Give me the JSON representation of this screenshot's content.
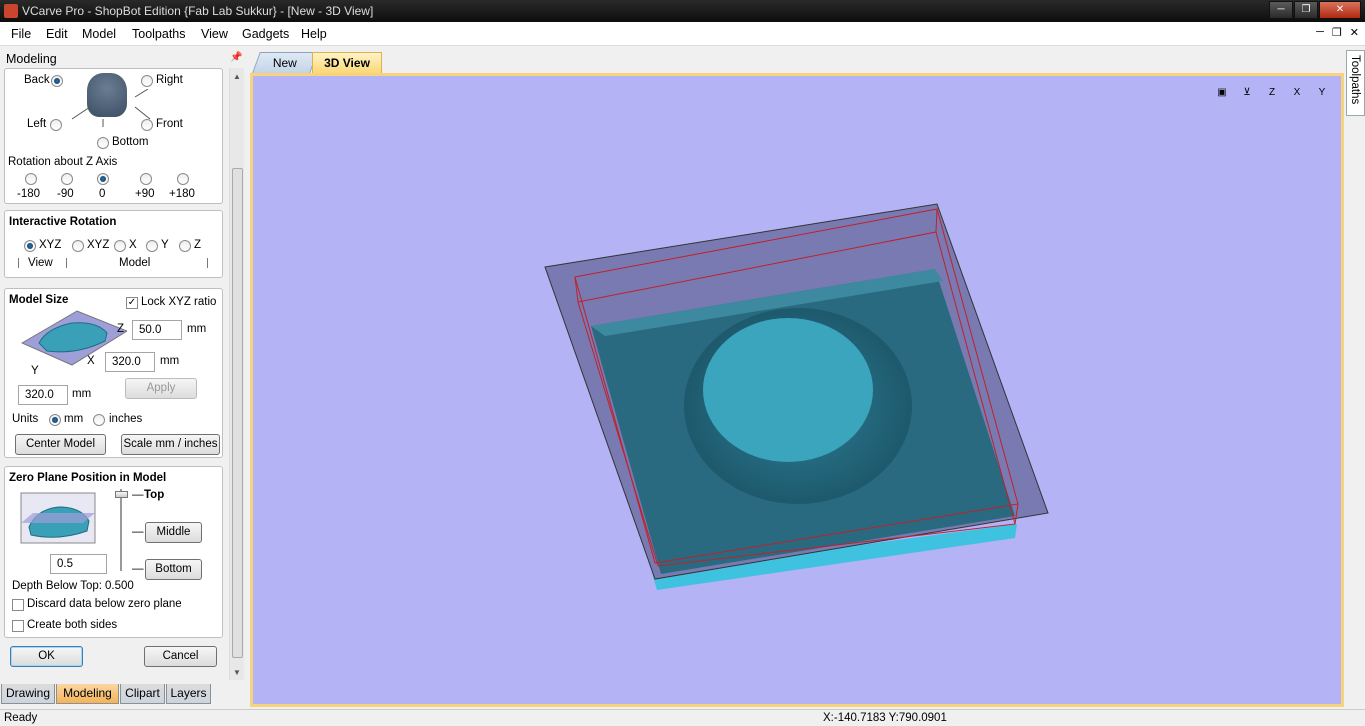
{
  "window": {
    "title": "VCarve Pro - ShopBot Edition {Fab Lab Sukkur} - [New - 3D View]",
    "controls": [
      "minimize",
      "restore",
      "close"
    ]
  },
  "menu": [
    "File",
    "Edit",
    "Model",
    "Toolpaths",
    "View",
    "Gadgets",
    "Help"
  ],
  "panel": {
    "title": "Modeling",
    "orientation": {
      "options": [
        {
          "label": "Back",
          "selected": true
        },
        {
          "label": "Right",
          "selected": false
        },
        {
          "label": "Left",
          "selected": false
        },
        {
          "label": "Front",
          "selected": false
        },
        {
          "label": "Bottom",
          "selected": false
        }
      ],
      "rotation_label": "Rotation about Z Axis",
      "rotation_options": [
        {
          "label": "-180",
          "selected": false
        },
        {
          "label": "-90",
          "selected": false
        },
        {
          "label": "0",
          "selected": true
        },
        {
          "label": "+90",
          "selected": false
        },
        {
          "label": "+180",
          "selected": false
        }
      ]
    },
    "interactive_rotation": {
      "heading": "Interactive Rotation",
      "options": [
        {
          "label": "XYZ",
          "selected": true
        },
        {
          "label": "XYZ",
          "selected": false
        },
        {
          "label": "X",
          "selected": false
        },
        {
          "label": "Y",
          "selected": false
        },
        {
          "label": "Z",
          "selected": false
        }
      ],
      "view_label": "View",
      "model_label": "Model"
    },
    "model_size": {
      "heading": "Model Size",
      "lock_label": "Lock XYZ ratio",
      "lock_checked": true,
      "z_label": "Z",
      "z_value": "50.0",
      "x_label": "X",
      "x_value": "320.0",
      "y_label": "Y",
      "y_value": "320.0",
      "unit": "mm",
      "apply_label": "Apply",
      "units_label": "Units",
      "units_options": [
        {
          "label": "mm",
          "selected": true
        },
        {
          "label": "inches",
          "selected": false
        }
      ],
      "center_label": "Center Model",
      "scale_label": "Scale mm / inches"
    },
    "zero_plane": {
      "heading": "Zero Plane Position in Model",
      "top_label": "Top",
      "middle_label": "Middle",
      "bottom_label": "Bottom",
      "value": "0.5",
      "depth_label": "Depth Below Top:",
      "depth_value": "0.500",
      "discard_label": "Discard data below zero plane",
      "discard_checked": false,
      "both_sides_label": "Create both sides",
      "both_sides_checked": false
    },
    "ok_label": "OK",
    "cancel_label": "Cancel"
  },
  "bottom_tabs": [
    {
      "label": "Drawing",
      "active": false
    },
    {
      "label": "Modeling",
      "active": true
    },
    {
      "label": "Clipart",
      "active": false
    },
    {
      "label": "Layers",
      "active": false
    }
  ],
  "doc_tabs": [
    {
      "label": "New",
      "active": false
    },
    {
      "label": "3D View",
      "active": true
    }
  ],
  "right_tab": "Toolpaths",
  "view_icons": [
    "zoom-extents-icon",
    "iso-view-icon",
    "top-view-z-icon",
    "front-view-x-icon",
    "side-view-y-icon"
  ],
  "colors": {
    "viewport_bg": "#b3b3f6",
    "model_fill": "#3aa0b8",
    "boundary_line": "#c0202a",
    "active_tab": "#f3b35b"
  },
  "status": {
    "left": "Ready",
    "coords": "X:-140.7183 Y:790.0901"
  }
}
